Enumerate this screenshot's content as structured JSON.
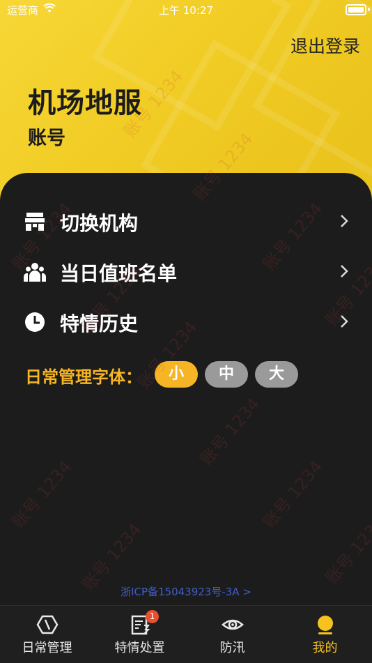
{
  "status_bar": {
    "carrier": "运营商",
    "time": "上午 10:27"
  },
  "header": {
    "logout_label": "退出登录",
    "org_name": "机场地服",
    "account_label": "账号"
  },
  "menu": {
    "items": [
      {
        "label": "切换机构",
        "icon": "switch-org-icon"
      },
      {
        "label": "当日值班名单",
        "icon": "people-icon"
      },
      {
        "label": "特情历史",
        "icon": "clock-icon"
      }
    ]
  },
  "font_size": {
    "label": "日常管理字体：",
    "options": [
      "小",
      "中",
      "大"
    ],
    "selected": "小"
  },
  "footer": {
    "icp": "浙ICP备15043923号-3A >"
  },
  "tabbar": {
    "tabs": [
      {
        "label": "日常管理",
        "icon": "hexagon-icon"
      },
      {
        "label": "特情处置",
        "icon": "report-icon",
        "badge": "1"
      },
      {
        "label": "防汛",
        "icon": "eye-icon"
      },
      {
        "label": "我的",
        "icon": "profile-icon"
      }
    ],
    "active": "我的"
  },
  "watermark": "账号 1234",
  "colors": {
    "accent": "#f5b524",
    "header_yellow": "#f2cf2a",
    "panel": "#1c1c1c",
    "link": "#3f5fc6"
  }
}
